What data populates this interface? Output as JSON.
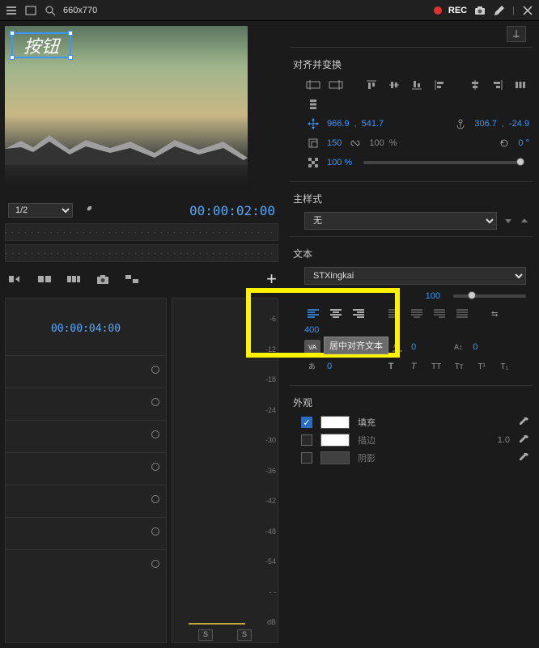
{
  "topbar": {
    "title": "660x770",
    "rec": "REC"
  },
  "preview": {
    "text_box": "按钮"
  },
  "transport": {
    "speed": "1/2",
    "timecode": "00:00:02:00",
    "timeline_tc": "00:00:04:00"
  },
  "alignTransform": {
    "title": "对齐并变换",
    "posX": "966.9",
    "posComma": ",",
    "posY": "541.7",
    "anchorX": "306.7",
    "anchorComma": ",",
    "anchorY": "-24.9",
    "scale": "150",
    "scaleLink": "100",
    "pct": "%",
    "rotation": "0 °",
    "opacity": "100 %"
  },
  "masterStyle": {
    "title": "主样式",
    "value": "无"
  },
  "text": {
    "title": "文本",
    "font": "STXingkai",
    "size": "100",
    "tracking": "0",
    "tracking_tooltip": "居中对齐文本",
    "leading": "0",
    "baseline": "0",
    "kerning": "400",
    "tsume": "0"
  },
  "appearance": {
    "title": "外观",
    "fill_label": "填充",
    "stroke_label": "描边",
    "stroke_width": "1.0",
    "shadow_label": "阴影",
    "colors": {
      "fill": "#ffffff",
      "stroke": "#ffffff",
      "shadow": "#404040"
    }
  },
  "audio_db": [
    "-6",
    "-12",
    "-18",
    "-24",
    "-30",
    "-36",
    "-42",
    "-48",
    "-54",
    "- -",
    "dB"
  ],
  "solo": "S"
}
